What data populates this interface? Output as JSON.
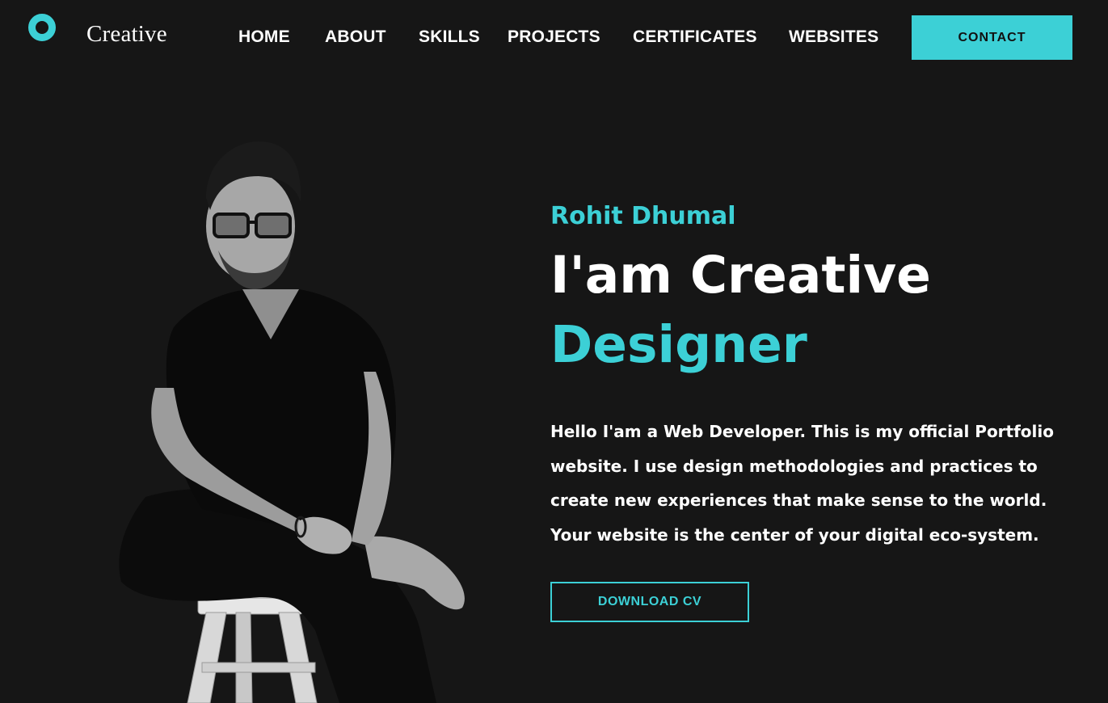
{
  "header": {
    "logo_text": "Creative",
    "nav": [
      {
        "label": "HOME"
      },
      {
        "label": "ABOUT"
      },
      {
        "label": "SKILLS"
      },
      {
        "label": "PROJECTS"
      },
      {
        "label": "CERTIFICATES"
      },
      {
        "label": "WEBSITES"
      }
    ],
    "contact_label": "CONTACT"
  },
  "hero": {
    "name": "Rohit Dhumal",
    "headline_line1": "I'am Creative",
    "headline_line2": "Designer",
    "description_lines": [
      "Hello I'am a Web Developer. This is my official Portfolio",
      "website. I use design methodologies and practices to",
      "create new experiences that make sense to the world.",
      "Your website is the center of your digital eco-system."
    ],
    "download_label": "DOWNLOAD CV"
  },
  "colors": {
    "background": "#161616",
    "accent": "#3cd0d6",
    "text": "#ffffff"
  },
  "icons": {
    "logo": "ring-logo-icon"
  }
}
